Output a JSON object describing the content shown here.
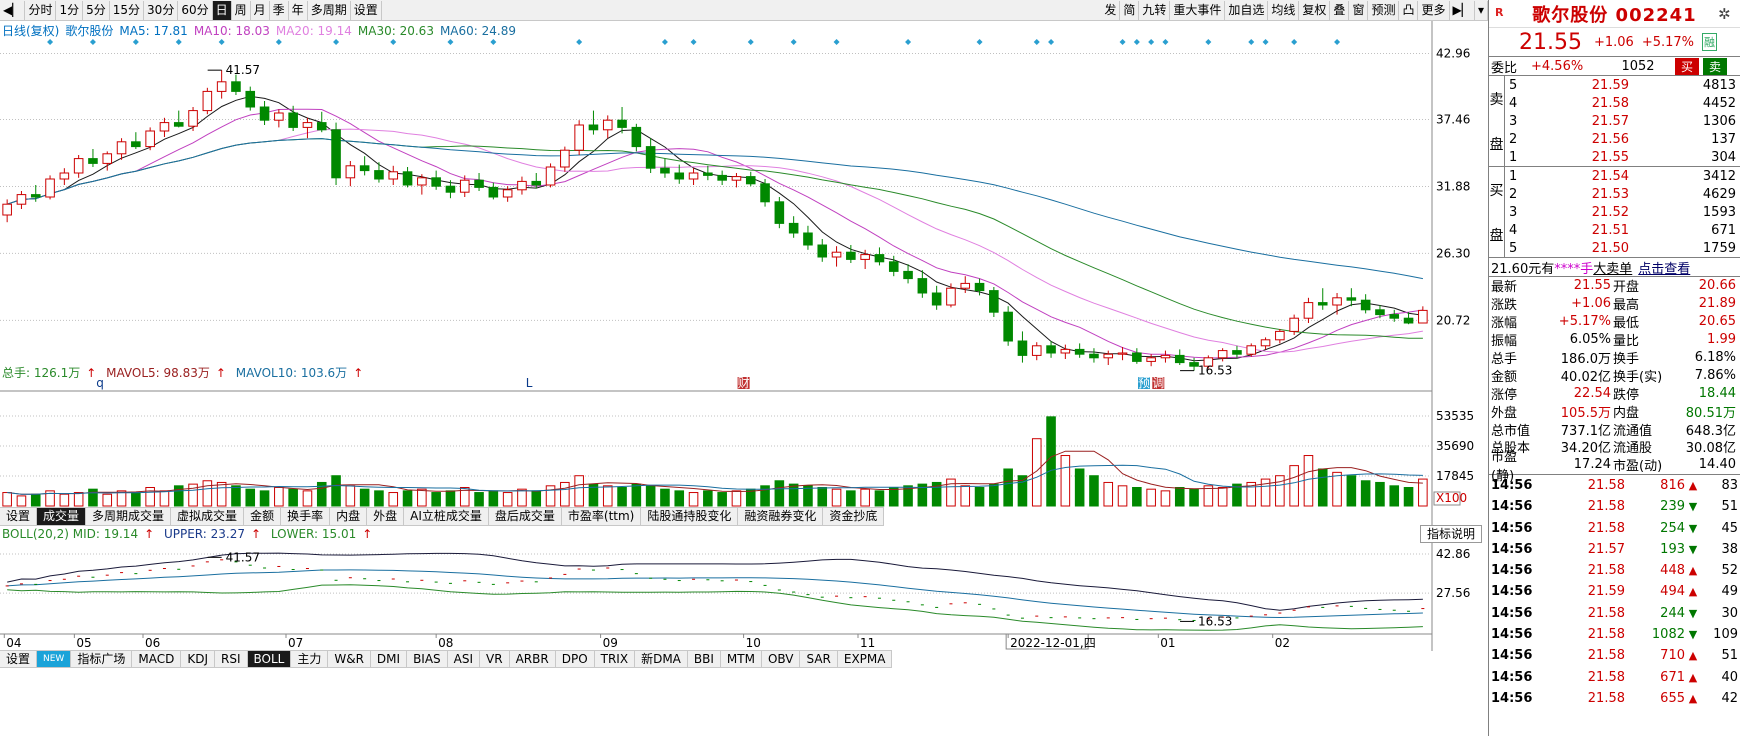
{
  "toolbar": {
    "left": [
      "分时",
      "1分",
      "5分",
      "15分",
      "30分",
      "60分",
      "日",
      "周",
      "月",
      "季",
      "年",
      "多周期",
      "设置"
    ],
    "active": "日",
    "right": [
      "发",
      "简",
      "九转",
      "重大事件",
      "加自选",
      "均线",
      "复权",
      "叠",
      "窗",
      "预测",
      "凸",
      "更多"
    ]
  },
  "kline": {
    "legend_prefix": "日线(复权)",
    "stock": "歌尔股份",
    "ma5": "MA5: 17.81",
    "ma10": "MA10: 18.03",
    "ma20": "MA20: 19.14",
    "ma30": "MA30: 20.63",
    "ma60": "MA60: 24.89",
    "y_labels": [
      "42.96",
      "37.46",
      "31.88",
      "26.30",
      "20.72"
    ],
    "y_values": [
      42.96,
      37.46,
      31.88,
      26.3,
      20.72
    ],
    "high_label": "41.57",
    "low_label": "16.53",
    "markers": [
      "q",
      "L",
      "财",
      "预",
      "调"
    ]
  },
  "volume": {
    "legend1": "总手: 126.1万",
    "legend2": "MAVOL5: 98.83万",
    "legend3": "MAVOL10: 103.6万",
    "y_labels": [
      "53535",
      "35690",
      "17845"
    ],
    "unit": "X100"
  },
  "tabs_mid": [
    "设置",
    "成交量",
    "多周期成交量",
    "虚拟成交量",
    "金额",
    "换手率",
    "内盘",
    "外盘",
    "AI立桩成交量",
    "盘后成交量",
    "市盈率(ttm)",
    "陆股通持股变化",
    "融资融券变化",
    "资金抄底"
  ],
  "boll": {
    "legend1": "BOLL(20,2) MID: 19.14",
    "legend2": "UPPER: 23.27",
    "legend3": "LOWER: 15.01",
    "y_labels": [
      "42.86",
      "27.56"
    ],
    "high_label": "41.57",
    "low_label": "16.53",
    "indicator_btn": "指标说明"
  },
  "x_axis": [
    "04",
    "05",
    "06",
    "07",
    "08",
    "09",
    "10",
    "11",
    "2022-12-01,四",
    "01",
    "02"
  ],
  "tabs_bottom": [
    "设置",
    "NEW",
    "指标广场",
    "MACD",
    "KDJ",
    "RSI",
    "BOLL",
    "主力",
    "W&R",
    "DMI",
    "BIAS",
    "ASI",
    "VR",
    "ARBR",
    "DPO",
    "TRIX",
    "新DMA",
    "BBI",
    "MTM",
    "OBV",
    "SAR",
    "EXPMA"
  ],
  "chart_data": {
    "type": "candlestick",
    "ylim": [
      15.0,
      44.0
    ],
    "candles": [
      [
        29.5,
        30.8,
        28.9,
        30.4
      ],
      [
        30.4,
        31.5,
        30.0,
        31.2
      ],
      [
        31.2,
        32.0,
        30.6,
        31.0
      ],
      [
        31.0,
        32.8,
        30.8,
        32.5
      ],
      [
        32.5,
        33.4,
        32.0,
        33.0
      ],
      [
        33.0,
        34.5,
        32.6,
        34.2
      ],
      [
        34.2,
        35.0,
        33.5,
        33.8
      ],
      [
        33.8,
        34.8,
        33.2,
        34.6
      ],
      [
        34.6,
        35.9,
        34.1,
        35.6
      ],
      [
        35.6,
        36.4,
        35.0,
        35.2
      ],
      [
        35.2,
        36.8,
        34.9,
        36.5
      ],
      [
        36.5,
        37.6,
        36.0,
        37.2
      ],
      [
        37.2,
        38.2,
        36.8,
        36.9
      ],
      [
        36.9,
        38.5,
        36.5,
        38.2
      ],
      [
        38.2,
        40.1,
        37.9,
        39.8
      ],
      [
        39.8,
        41.57,
        39.2,
        40.6
      ],
      [
        40.6,
        41.2,
        39.5,
        39.8
      ],
      [
        39.8,
        40.2,
        38.2,
        38.5
      ],
      [
        38.5,
        39.0,
        37.0,
        37.4
      ],
      [
        37.4,
        38.3,
        36.8,
        38.0
      ],
      [
        38.0,
        38.6,
        36.5,
        36.8
      ],
      [
        36.8,
        37.6,
        35.9,
        37.2
      ],
      [
        37.2,
        38.1,
        36.4,
        36.6
      ],
      [
        36.6,
        37.2,
        32.0,
        32.6
      ],
      [
        32.6,
        34.0,
        31.9,
        33.6
      ],
      [
        33.6,
        34.4,
        32.8,
        33.2
      ],
      [
        33.2,
        33.9,
        32.2,
        32.5
      ],
      [
        32.5,
        33.6,
        32.0,
        33.1
      ],
      [
        33.1,
        33.5,
        31.8,
        32.0
      ],
      [
        32.0,
        32.9,
        31.2,
        32.6
      ],
      [
        32.6,
        33.2,
        31.6,
        31.9
      ],
      [
        31.9,
        32.4,
        30.9,
        31.4
      ],
      [
        31.4,
        32.8,
        31.0,
        32.4
      ],
      [
        32.4,
        33.0,
        31.5,
        31.8
      ],
      [
        31.8,
        32.2,
        30.8,
        31.0
      ],
      [
        31.0,
        31.9,
        30.6,
        31.6
      ],
      [
        31.6,
        32.7,
        31.2,
        32.3
      ],
      [
        32.3,
        33.0,
        31.7,
        32.0
      ],
      [
        32.0,
        33.8,
        31.8,
        33.5
      ],
      [
        33.5,
        35.2,
        33.1,
        34.9
      ],
      [
        34.9,
        37.4,
        34.5,
        37.0
      ],
      [
        37.0,
        38.2,
        36.2,
        36.6
      ],
      [
        36.6,
        37.8,
        35.9,
        37.4
      ],
      [
        37.4,
        38.5,
        36.3,
        36.8
      ],
      [
        36.8,
        37.1,
        34.8,
        35.2
      ],
      [
        35.2,
        35.9,
        33.0,
        33.4
      ],
      [
        33.4,
        34.2,
        32.6,
        33.0
      ],
      [
        33.0,
        33.7,
        32.1,
        32.5
      ],
      [
        32.5,
        33.4,
        32.0,
        33.0
      ],
      [
        33.0,
        33.6,
        32.4,
        32.8
      ],
      [
        32.8,
        33.2,
        32.0,
        32.4
      ],
      [
        32.4,
        33.0,
        31.8,
        32.7
      ],
      [
        32.7,
        33.1,
        31.9,
        32.1
      ],
      [
        32.1,
        32.5,
        30.2,
        30.6
      ],
      [
        30.6,
        31.0,
        28.4,
        28.8
      ],
      [
        28.8,
        29.4,
        27.6,
        28.0
      ],
      [
        28.0,
        28.6,
        26.6,
        27.0
      ],
      [
        27.0,
        27.5,
        25.6,
        26.0
      ],
      [
        26.0,
        26.9,
        25.2,
        26.4
      ],
      [
        26.4,
        27.0,
        25.5,
        25.8
      ],
      [
        25.8,
        26.6,
        25.0,
        26.2
      ],
      [
        26.2,
        26.8,
        25.3,
        25.6
      ],
      [
        25.6,
        26.1,
        24.4,
        24.8
      ],
      [
        24.8,
        25.4,
        23.8,
        24.2
      ],
      [
        24.2,
        24.9,
        22.6,
        23.0
      ],
      [
        23.0,
        23.6,
        21.6,
        22.0
      ],
      [
        22.0,
        23.8,
        21.8,
        23.4
      ],
      [
        23.4,
        24.4,
        23.0,
        23.8
      ],
      [
        23.8,
        24.2,
        22.8,
        23.2
      ],
      [
        23.2,
        23.5,
        21.0,
        21.4
      ],
      [
        21.4,
        21.9,
        18.6,
        19.0
      ],
      [
        19.0,
        19.8,
        17.2,
        17.8
      ],
      [
        17.8,
        18.9,
        17.4,
        18.6
      ],
      [
        18.6,
        19.0,
        17.6,
        18.0
      ],
      [
        18.0,
        18.7,
        17.5,
        18.3
      ],
      [
        18.3,
        18.8,
        17.6,
        17.9
      ],
      [
        17.9,
        18.4,
        17.2,
        17.6
      ],
      [
        17.6,
        18.2,
        17.0,
        17.9
      ],
      [
        17.9,
        18.5,
        17.4,
        18.0
      ],
      [
        18.0,
        18.4,
        17.1,
        17.3
      ],
      [
        17.3,
        17.9,
        16.9,
        17.6
      ],
      [
        17.6,
        18.2,
        17.2,
        17.8
      ],
      [
        17.8,
        18.3,
        17.0,
        17.2
      ],
      [
        17.2,
        17.6,
        16.53,
        16.9
      ],
      [
        16.9,
        17.8,
        16.7,
        17.6
      ],
      [
        17.6,
        18.4,
        17.3,
        18.2
      ],
      [
        18.2,
        18.6,
        17.6,
        17.9
      ],
      [
        17.9,
        18.8,
        17.7,
        18.6
      ],
      [
        18.6,
        19.3,
        18.3,
        19.1
      ],
      [
        19.1,
        20.0,
        18.8,
        19.8
      ],
      [
        19.8,
        21.2,
        19.5,
        20.9
      ],
      [
        20.9,
        22.6,
        20.5,
        22.2
      ],
      [
        22.2,
        23.4,
        21.6,
        22.0
      ],
      [
        22.0,
        23.0,
        21.2,
        22.6
      ],
      [
        22.6,
        23.4,
        21.9,
        22.4
      ],
      [
        22.4,
        22.9,
        21.3,
        21.6
      ],
      [
        21.6,
        22.0,
        20.9,
        21.2
      ],
      [
        21.2,
        21.6,
        20.6,
        20.9
      ],
      [
        20.9,
        21.4,
        20.4,
        20.5
      ],
      [
        20.5,
        21.89,
        20.65,
        21.55
      ]
    ],
    "volumes": [
      8,
      6,
      7,
      9,
      7,
      8,
      10,
      7,
      9,
      8,
      11,
      9,
      12,
      13,
      15,
      14,
      12,
      10,
      9,
      11,
      10,
      9,
      14,
      18,
      12,
      10,
      9,
      8,
      9,
      10,
      8,
      9,
      11,
      8,
      9,
      8,
      10,
      9,
      12,
      14,
      18,
      13,
      12,
      11,
      13,
      12,
      10,
      9,
      8,
      9,
      8,
      9,
      10,
      12,
      15,
      13,
      12,
      11,
      10,
      9,
      10,
      9,
      11,
      12,
      13,
      14,
      16,
      12,
      11,
      13,
      22,
      18,
      40,
      53,
      30,
      22,
      18,
      14,
      12,
      11,
      10,
      9,
      11,
      10,
      12,
      11,
      13,
      14,
      16,
      18,
      24,
      30,
      22,
      20,
      18,
      15,
      14,
      12,
      11,
      16
    ]
  },
  "panel": {
    "title": "歌尔股份 002241",
    "price": "21.55",
    "change": "+1.06",
    "pct": "+5.17%",
    "tag": "融",
    "weibi_label": "委比",
    "weibi_pct": "+4.56%",
    "weibi_diff": "1052",
    "buy_btn": "买",
    "sell_btn": "卖",
    "sell_side": "卖盘",
    "buy_side": "买盘",
    "asks": [
      {
        "lv": "5",
        "price": "21.59",
        "vol": "4813"
      },
      {
        "lv": "4",
        "price": "21.58",
        "vol": "4452"
      },
      {
        "lv": "3",
        "price": "21.57",
        "vol": "1306"
      },
      {
        "lv": "2",
        "price": "21.56",
        "vol": "137"
      },
      {
        "lv": "1",
        "price": "21.55",
        "vol": "304"
      }
    ],
    "bids": [
      {
        "lv": "1",
        "price": "21.54",
        "vol": "3412"
      },
      {
        "lv": "2",
        "price": "21.53",
        "vol": "4629"
      },
      {
        "lv": "3",
        "price": "21.52",
        "vol": "1593"
      },
      {
        "lv": "4",
        "price": "21.51",
        "vol": "671"
      },
      {
        "lv": "5",
        "price": "21.50",
        "vol": "1759"
      }
    ],
    "bigorder": {
      "a": "21.60元有",
      "b": "****手",
      "c": "大卖单",
      "d": "点击查看"
    },
    "stats": [
      {
        "l1": "最新",
        "v1": "21.55",
        "c1": "red",
        "l2": "开盘",
        "v2": "20.66",
        "c2": "red"
      },
      {
        "l1": "涨跌",
        "v1": "+1.06",
        "c1": "red",
        "l2": "最高",
        "v2": "21.89",
        "c2": "red"
      },
      {
        "l1": "涨幅",
        "v1": "+5.17%",
        "c1": "red",
        "l2": "最低",
        "v2": "20.65",
        "c2": "red"
      },
      {
        "l1": "振幅",
        "v1": "6.05%",
        "c1": "",
        "l2": "量比",
        "v2": "1.99",
        "c2": "red"
      },
      {
        "l1": "总手",
        "v1": "186.0万",
        "c1": "",
        "l2": "换手",
        "v2": "6.18%",
        "c2": ""
      },
      {
        "l1": "金额",
        "v1": "40.02亿",
        "c1": "",
        "l2": "换手(实)",
        "v2": "7.86%",
        "c2": ""
      },
      {
        "l1": "涨停",
        "v1": "22.54",
        "c1": "red",
        "l2": "跌停",
        "v2": "18.44",
        "c2": "green"
      },
      {
        "l1": "外盘",
        "v1": "105.5万",
        "c1": "red",
        "l2": "内盘",
        "v2": "80.51万",
        "c2": "green"
      },
      {
        "l1": "总市值",
        "v1": "737.1亿",
        "c1": "",
        "l2": "流通值",
        "v2": "648.3亿",
        "c2": ""
      },
      {
        "l1": "总股本",
        "v1": "34.20亿",
        "c1": "",
        "l2": "流通股",
        "v2": "30.08亿",
        "c2": ""
      },
      {
        "l1": "市盈(静)",
        "v1": "17.24",
        "c1": "",
        "l2": "市盈(动)",
        "v2": "14.40",
        "c2": ""
      }
    ],
    "ticks": [
      {
        "t": "14:56",
        "p": "21.58",
        "v": "816",
        "dir": "up",
        "n": "83"
      },
      {
        "t": "14:56",
        "p": "21.58",
        "v": "239",
        "dir": "down",
        "n": "51"
      },
      {
        "t": "14:56",
        "p": "21.58",
        "v": "254",
        "dir": "down",
        "n": "45"
      },
      {
        "t": "14:56",
        "p": "21.57",
        "v": "193",
        "dir": "down",
        "n": "38"
      },
      {
        "t": "14:56",
        "p": "21.58",
        "v": "448",
        "dir": "up",
        "n": "52"
      },
      {
        "t": "14:56",
        "p": "21.59",
        "v": "494",
        "dir": "up",
        "n": "49"
      },
      {
        "t": "14:56",
        "p": "21.58",
        "v": "244",
        "dir": "down",
        "n": "30"
      },
      {
        "t": "14:56",
        "p": "21.58",
        "v": "1082",
        "dir": "down",
        "n": "109"
      },
      {
        "t": "14:56",
        "p": "21.58",
        "v": "710",
        "dir": "up",
        "n": "51"
      },
      {
        "t": "14:56",
        "p": "21.58",
        "v": "671",
        "dir": "up",
        "n": "40"
      },
      {
        "t": "14:56",
        "p": "21.58",
        "v": "655",
        "dir": "up",
        "n": "42"
      }
    ],
    "colors": {
      "up": "#cc0000",
      "down": "#008800"
    }
  }
}
